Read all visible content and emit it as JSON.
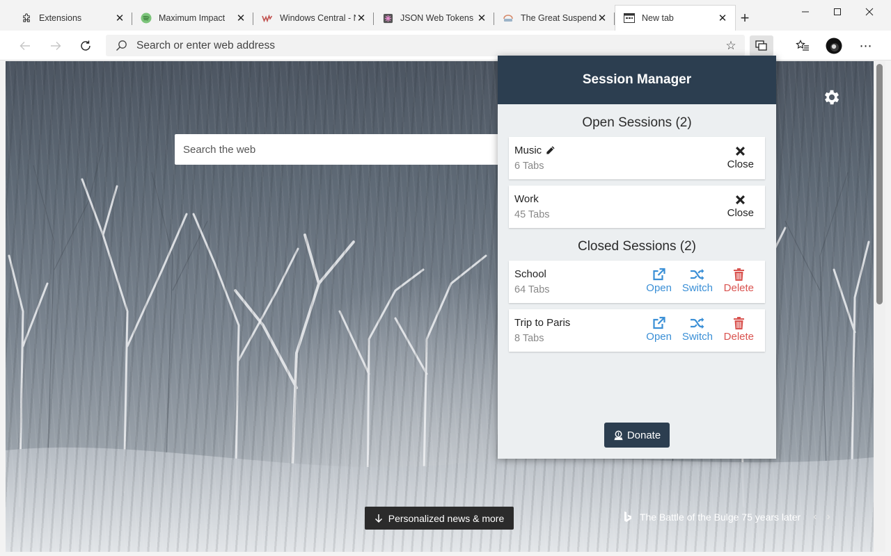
{
  "tabs": [
    {
      "title": "Extensions",
      "icon": "puzzle-icon"
    },
    {
      "title": "Maximum Impact",
      "icon": "spotify-icon"
    },
    {
      "title": "Windows Central - N",
      "icon": "windows-central-icon"
    },
    {
      "title": "JSON Web Tokens -",
      "icon": "jwt-icon"
    },
    {
      "title": "The Great Suspende",
      "icon": "great-suspender-icon"
    },
    {
      "title": "New tab",
      "icon": "newtab-icon"
    }
  ],
  "window_controls": {
    "minimize": "—",
    "maximize": "☐",
    "close": "✕"
  },
  "address_bar": {
    "placeholder": "Search or enter web address"
  },
  "page": {
    "search_placeholder": "Search the web",
    "news_button": "Personalized news & more",
    "image_caption": "The Battle of the Bulge 75 years later"
  },
  "session_manager": {
    "title": "Session Manager",
    "open_heading": "Open Sessions (2)",
    "closed_heading": "Closed Sessions (2)",
    "open_sessions": [
      {
        "name": "Music",
        "tabs": "6 Tabs",
        "close_label": "Close"
      },
      {
        "name": "Work",
        "tabs": "45 Tabs",
        "close_label": "Close"
      }
    ],
    "closed_sessions": [
      {
        "name": "School",
        "tabs": "64 Tabs",
        "open_label": "Open",
        "switch_label": "Switch",
        "delete_label": "Delete"
      },
      {
        "name": "Trip to Paris",
        "tabs": "8 Tabs",
        "open_label": "Open",
        "switch_label": "Switch",
        "delete_label": "Delete"
      }
    ],
    "donate_label": "Donate"
  },
  "colors": {
    "header": "#2c3e50",
    "link_blue": "#3a8fd6",
    "delete_red": "#d9534f",
    "muted": "#888888"
  }
}
